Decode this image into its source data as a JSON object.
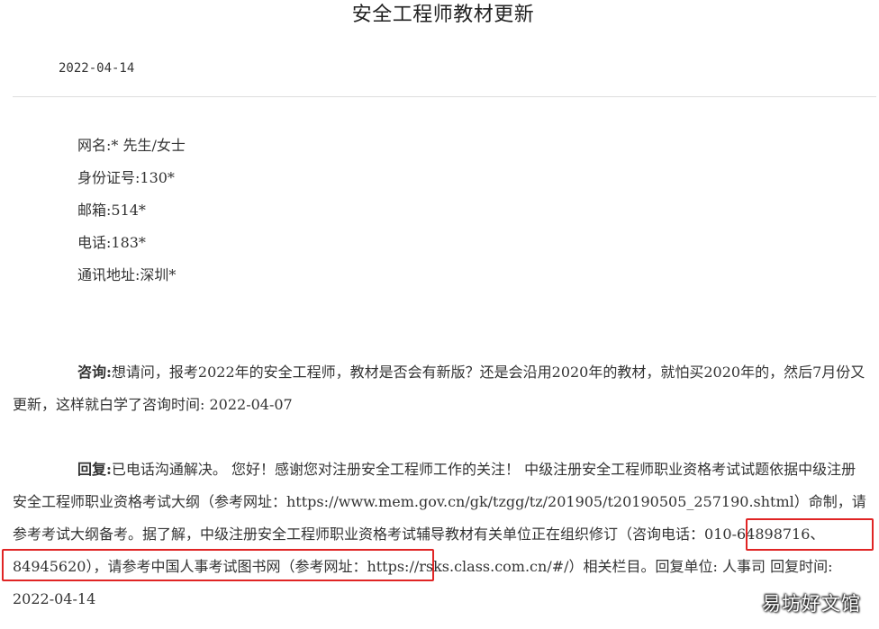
{
  "article": {
    "title": "安全工程师教材更新",
    "date": "2022-04-14"
  },
  "personal_info": {
    "name": "网名:* 先生/女士",
    "id_number": "身份证号:130*",
    "postcode": "邮箱:514*",
    "phone": "电话:183*",
    "address": "通讯地址:深圳*"
  },
  "inquiry": {
    "label": "咨询:",
    "text": "想请问，报考2022年的安全工程师，教材是否会有新版？还是会沿用2020年的教材，就怕买2020年的，然后7月份又更新，这样就白学了咨询时间: 2022-04-07"
  },
  "reply": {
    "label": "回复:",
    "text_1": "已电话沟通解决。 您好！感谢您对注册安全工程师工作的关注！ 中级注册安全工程师职业资格考试试题依据中级注册安全工程师职业资格考试大纲（参考网址：https://www.mem.gov.cn/gk/tzgg/tz/201905/t20190505_257190.shtml）命制，请参考考试大纲备考。",
    "highlight": "据了解，中级注册安全工程师职业资格考试辅导教材有关单位正在组织修订",
    "text_2": "（咨询电话：010-64898716、84945620），请参考中国人事考试图书网（参考网址：https://rsks.class.com.cn/#/）相关栏目。回复单位: 人事司",
    "reply_time": "回复时间: 2022-04-14"
  },
  "watermark": "易坊好文馆",
  "colors": {
    "highlight_border": "#e02424",
    "text": "#333333",
    "divider": "#dddddd"
  }
}
